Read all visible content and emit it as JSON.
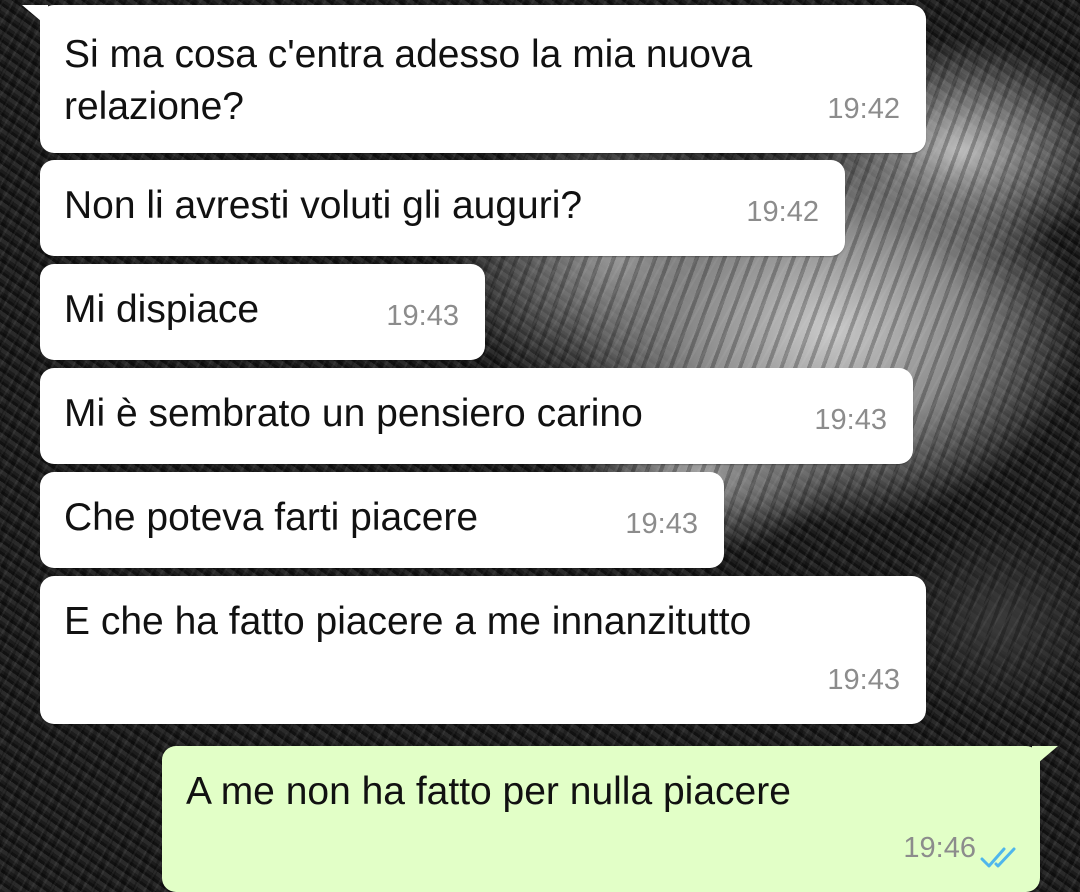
{
  "colors": {
    "incoming_bubble": "#ffffff",
    "outgoing_bubble": "#e2ffc7",
    "timestamp": "#8c8c8c",
    "read_ticks": "#4fb6ec"
  },
  "messages": [
    {
      "direction": "incoming",
      "text": "Si ma cosa c'entra adesso la mia nuova relazione?",
      "time": "19:42"
    },
    {
      "direction": "incoming",
      "text": "Non li avresti voluti gli auguri?",
      "time": "19:42"
    },
    {
      "direction": "incoming",
      "text": "Mi dispiace",
      "time": "19:43"
    },
    {
      "direction": "incoming",
      "text": "Mi è sembrato un pensiero carino",
      "time": "19:43"
    },
    {
      "direction": "incoming",
      "text": "Che poteva farti piacere",
      "time": "19:43"
    },
    {
      "direction": "incoming",
      "text": "E che ha fatto piacere a me innanzitutto",
      "time": "19:43"
    },
    {
      "direction": "outgoing",
      "text": "A me non ha fatto per nulla piacere",
      "time": "19:46",
      "status_icon": "double-check-read-icon"
    }
  ]
}
